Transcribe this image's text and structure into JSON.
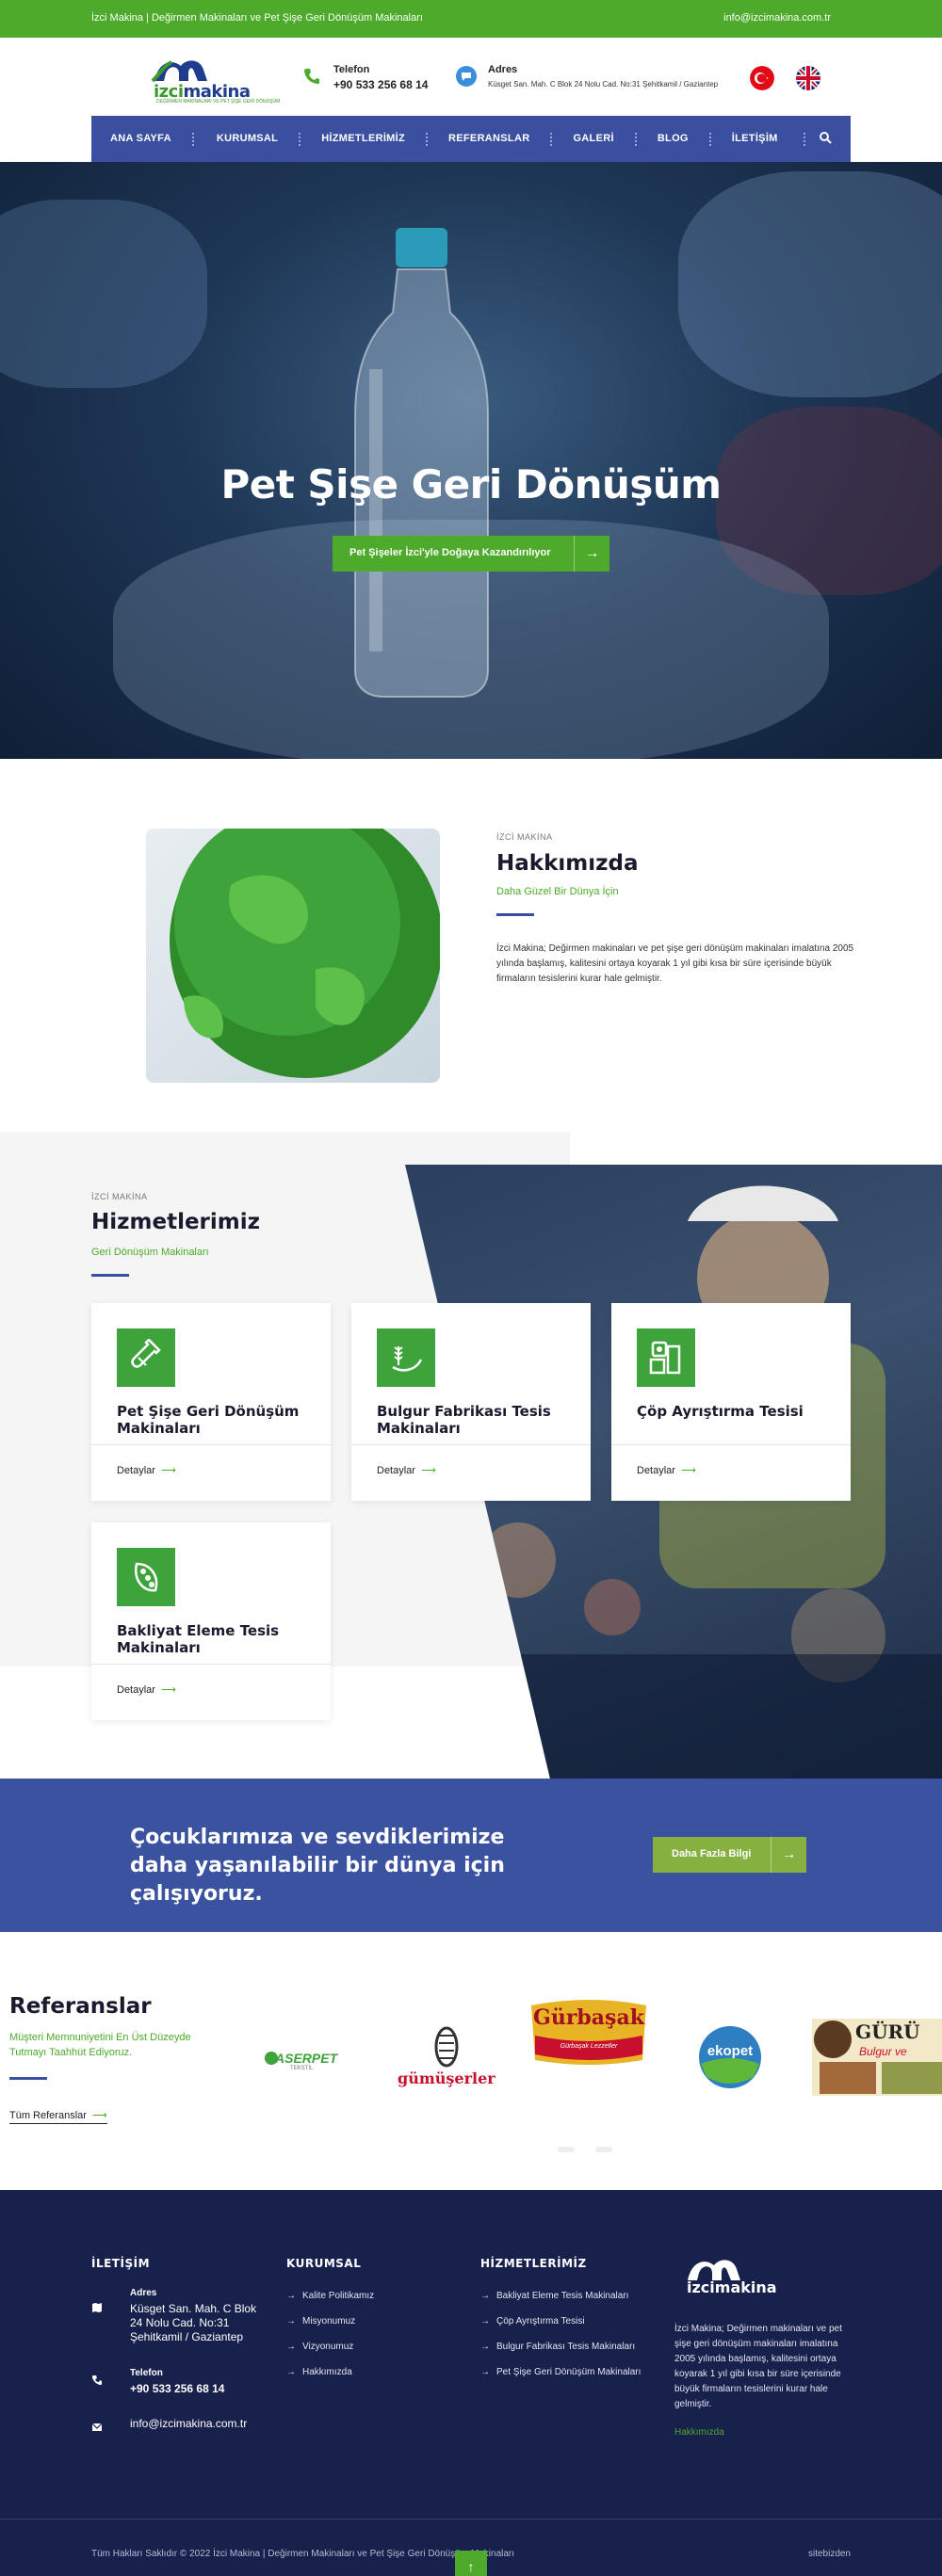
{
  "topbar": {
    "tagline": "İzci Makina | Değirmen Makinaları ve Pet Şişe Geri Dönüşüm Makinaları",
    "email": "info@izcimakina.com.tr"
  },
  "header": {
    "logo": {
      "name": "izcimakina",
      "part1": "izci",
      "part2": "makina",
      "tagline": "DEĞİRMEN MAKİNALARI VE PET ŞİŞE GERİ DÖNÜŞÜM"
    },
    "phone": {
      "label": "Telefon",
      "value": "+90 533 256 68 14",
      "icon": "phone-icon"
    },
    "address": {
      "label": "Adres",
      "value": "Küsget San. Mah. C Blok 24 Nolu Cad. No:31 Şehitkamil / Gaziantep",
      "icon": "chat-bubble-icon"
    },
    "languages": [
      "tr-flag",
      "gb-flag"
    ]
  },
  "nav": {
    "items": [
      "ANA SAYFA",
      "KURUMSAL",
      "HİZMETLERİMİZ",
      "REFERANSLAR",
      "GALERİ",
      "BLOG",
      "İLETİŞİM"
    ],
    "search_icon": "search-icon"
  },
  "hero": {
    "title": "Pet Şişe Geri Dönüşüm",
    "button": "Pet Şişeler İzci'yle Doğaya Kazandırılıyor",
    "button_icon": "arrow-right-icon"
  },
  "about": {
    "tag": "İZCİ MAKİNA",
    "title": "Hakkımızda",
    "subtitle": "Daha Güzel Bir Dünya İçin",
    "text": "İzci Makina; Değirmen makinaları ve pet şişe geri dönüşüm makinaları imalatına 2005 yılında başlamış, kalitesini ortaya koyarak 1 yıl gibi kısa bir süre içerisinde büyük firmaların tesislerini kurar hale gelmiştir."
  },
  "services": {
    "tag": "İZCİ MAKİNA",
    "title": "Hizmetlerimiz",
    "subtitle": "Geri Dönüşüm Makinaları",
    "more_label": "Detaylar",
    "cards": [
      {
        "title": "Pet Şişe Geri Dönüşüm Makinaları",
        "icon": "bottle-icon"
      },
      {
        "title": "Bulgur Fabrikası Tesis Makinaları",
        "icon": "wheat-icon"
      },
      {
        "title": "Çöp Ayrıştırma Tesisi",
        "icon": "recycling-machine-icon"
      },
      {
        "title": "Bakliyat Eleme Tesis Makinaları",
        "icon": "legume-icon"
      }
    ]
  },
  "cta": {
    "text": "Çocuklarımıza ve sevdiklerimize daha yaşanılabilir bir dünya için çalışıyoruz.",
    "button": "Daha Fazla Bilgi"
  },
  "references": {
    "title": "Referanslar",
    "subtitle": "Müşteri Memnuniyetini En Üst Düzeyde Tutmayı Taahhüt Ediyoruz.",
    "all_label": "Tüm Referanslar",
    "logos": [
      {
        "name": "ASERPET",
        "sub": "TEKSTİL"
      },
      {
        "name": "gümüşerler",
        "sub": ""
      },
      {
        "name": "Gürbaşak",
        "sub": "Gürbaşak Lezzetler"
      },
      {
        "name": "ekopet",
        "sub": ""
      },
      {
        "name": "GÜRÜ",
        "sub": "Bulgur ve"
      }
    ]
  },
  "footer": {
    "contact_title": "İLETİŞİM",
    "address_label": "Adres",
    "address_value": "Küsget San. Mah. C Blok 24 Nolu Cad. No:31 Şehitkamil / Gaziantep",
    "phone_label": "Telefon",
    "phone_value": "+90 533 256 68 14",
    "email": "info@izcimakina.com.tr",
    "corporate_title": "KURUMSAL",
    "corporate_links": [
      "Kalite Politikamız",
      "Misyonumuz",
      "Vizyonumuz",
      "Hakkımızda"
    ],
    "services_title": "HİZMETLERİMİZ",
    "services_links": [
      "Bakliyat Eleme Tesis Makinaları",
      "Çöp Ayrıştırma Tesisi",
      "Bulgur Fabrikası Tesis Makinaları",
      "Pet Şişe Geri Dönüşüm Makinaları"
    ],
    "about_text": "İzci Makina; Değirmen makinaları ve pet şişe geri dönüşüm makinaları imalatına 2005 yılında başlamış, kalitesini ortaya koyarak 1 yıl gibi kısa bir süre içerisinde büyük firmaların tesislerini kurar hale gelmiştir.",
    "about_link": "Hakkımızda",
    "copyright": "Tüm Hakları Saklıdır © 2022 İzci Makina | Değirmen Makinaları ve Pet Şişe Geri Dönüşüm Makinaları",
    "signature": "sitebizden"
  },
  "colors": {
    "green": "#4daa2a",
    "navy": "#3a4f9f",
    "footer": "#17214c"
  }
}
